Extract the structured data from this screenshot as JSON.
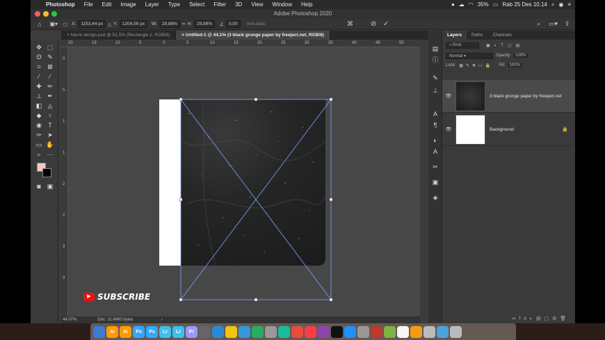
{
  "menubar": {
    "app": "Photoshop",
    "items": [
      "File",
      "Edit",
      "Image",
      "Layer",
      "Type",
      "Select",
      "Filter",
      "3D",
      "View",
      "Window",
      "Help"
    ],
    "battery": "35%",
    "clock": "Rab 25 Des 10.14"
  },
  "window_title": "Adobe Photoshop 2020",
  "options": {
    "x_label": "X:",
    "x_value": "1153,44 px",
    "y_label": "Y:",
    "y_value": "1204,59 px",
    "w_label": "W:",
    "w_value": "29,88%",
    "h_label": "H:",
    "h_value": "29,88%",
    "angle_value": "0,00",
    "antialias": "Anti-alias"
  },
  "tabs": [
    {
      "label": "future design.psd @ 51,5% (Rectangle 2, RGB/8)"
    },
    {
      "label": "Untitled-1 @ 44,1% (3 black grunge paper by freeject.net, RGB/8)"
    }
  ],
  "ruler_h": [
    "20",
    "15",
    "10",
    "5",
    "0",
    "5",
    "10",
    "15",
    "20",
    "25",
    "30",
    "35",
    "40",
    "45",
    "50"
  ],
  "ruler_v": [
    "0",
    "5",
    "1",
    "1",
    "2",
    "2",
    "3",
    "3"
  ],
  "status": {
    "zoom": "44,07%",
    "doc": "Doc: 11,4M/0 bytes"
  },
  "panel": {
    "tabs": [
      "Layers",
      "Paths",
      "Channels"
    ],
    "kind": "Kind",
    "blend": "Normal",
    "opacity_label": "Opacity:",
    "opacity_value": "100%",
    "lock_label": "Lock:",
    "fill_label": "Fill:",
    "fill_value": "100%",
    "layers": [
      {
        "name": "3 black grunge paper by freeject.net"
      },
      {
        "name": "Background"
      }
    ]
  },
  "overlay": {
    "subscribe": "SUBSCRIBE"
  },
  "dock": [
    {
      "label": "",
      "color": "#3a7bd5"
    },
    {
      "label": "Ai",
      "color": "#ff9a00"
    },
    {
      "label": "Ai",
      "color": "#ff9a00"
    },
    {
      "label": "Ps",
      "color": "#31a8ff"
    },
    {
      "label": "Ps",
      "color": "#31a8ff"
    },
    {
      "label": "Lr",
      "color": "#3dc0f0"
    },
    {
      "label": "Lr",
      "color": "#3dc0f0"
    },
    {
      "label": "Pr",
      "color": "#9999ff"
    },
    {
      "label": "",
      "color": "#666"
    },
    {
      "label": "",
      "color": "#2a8ad4"
    },
    {
      "label": "",
      "color": "#f1c40f"
    },
    {
      "label": "",
      "color": "#3498db"
    },
    {
      "label": "",
      "color": "#27ae60"
    },
    {
      "label": "",
      "color": "#999"
    },
    {
      "label": "",
      "color": "#1abc9c"
    },
    {
      "label": "",
      "color": "#e74c3c"
    },
    {
      "label": "",
      "color": "#fc3c44"
    },
    {
      "label": "",
      "color": "#8e44ad"
    },
    {
      "label": "",
      "color": "#111"
    },
    {
      "label": "",
      "color": "#1e90ff"
    },
    {
      "label": "",
      "color": "#999"
    },
    {
      "label": "",
      "color": "#c0392b"
    },
    {
      "label": "",
      "color": "#7cb342"
    },
    {
      "label": "",
      "color": "#f5f5f5"
    },
    {
      "label": "",
      "color": "#f39c12"
    },
    {
      "label": "",
      "color": "#bbb"
    },
    {
      "label": "",
      "color": "#4aa3df"
    },
    {
      "label": "",
      "color": "#bbb"
    }
  ],
  "colors": {
    "fg_swatch": "#f4c8c6",
    "bg_swatch": "#000000",
    "accent": "#5aa0ff"
  }
}
